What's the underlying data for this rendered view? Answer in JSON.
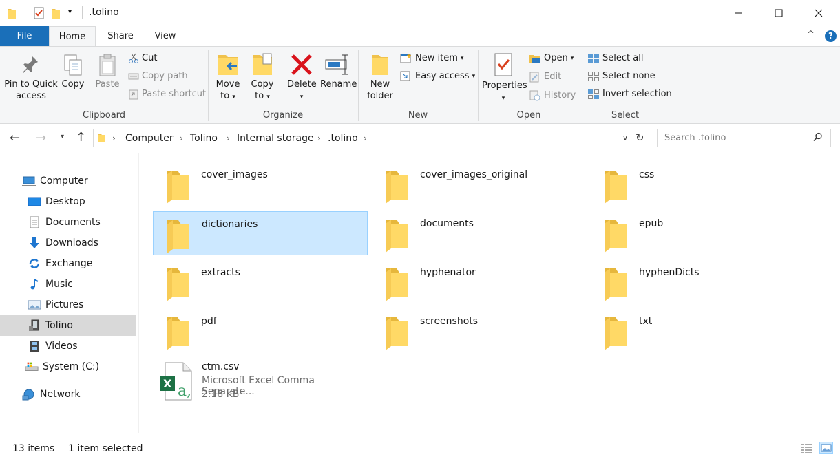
{
  "window": {
    "title": ".tolino",
    "accent": "#1a6fb9",
    "selection_color": "#cce8ff"
  },
  "tabs": {
    "file": "File",
    "home": "Home",
    "share": "Share",
    "view": "View"
  },
  "ribbon": {
    "clipboard": {
      "label": "Clipboard",
      "pin": "Pin to Quick access",
      "pin_l1": "Pin to Quick",
      "pin_l2": "access",
      "copy": "Copy",
      "paste": "Paste",
      "cut": "Cut",
      "copy_path": "Copy path",
      "paste_shortcut": "Paste shortcut"
    },
    "organize": {
      "label": "Organize",
      "move_l1": "Move",
      "move_l2": "to",
      "copy_l1": "Copy",
      "copy_l2": "to",
      "delete": "Delete",
      "rename": "Rename"
    },
    "new": {
      "label": "New",
      "new_folder_l1": "New",
      "new_folder_l2": "folder",
      "new_item": "New item",
      "easy_access": "Easy access"
    },
    "open": {
      "label": "Open",
      "properties": "Properties",
      "open": "Open",
      "edit": "Edit",
      "history": "History"
    },
    "select": {
      "label": "Select",
      "select_all": "Select all",
      "select_none": "Select none",
      "invert_selection": "Invert selection"
    }
  },
  "address": {
    "crumbs": [
      "Computer",
      "Tolino",
      "Internal storage",
      ".tolino"
    ],
    "search_placeholder": "Search .tolino"
  },
  "nav_pane": {
    "items": [
      {
        "label": "Computer",
        "icon": "computer-icon"
      },
      {
        "label": "Desktop",
        "icon": "desktop-icon"
      },
      {
        "label": "Documents",
        "icon": "documents-icon"
      },
      {
        "label": "Downloads",
        "icon": "downloads-icon"
      },
      {
        "label": "Exchange",
        "icon": "exchange-icon"
      },
      {
        "label": "Music",
        "icon": "music-icon"
      },
      {
        "label": "Pictures",
        "icon": "pictures-icon"
      },
      {
        "label": "Tolino",
        "icon": "device-icon",
        "selected": true
      },
      {
        "label": "Videos",
        "icon": "videos-icon"
      },
      {
        "label": "System (C:)",
        "icon": "drive-icon"
      },
      {
        "label": "Network",
        "icon": "network-icon"
      }
    ]
  },
  "content": {
    "folders": [
      "cover_images",
      "cover_images_original",
      "css",
      "dictionaries",
      "documents",
      "epub",
      "extracts",
      "hyphenator",
      "hyphenDicts",
      "pdf",
      "screenshots",
      "txt"
    ],
    "selected_index": 3,
    "file": {
      "name": "ctm.csv",
      "type": "Microsoft Excel Comma Separate...",
      "size": "2.18 KB"
    }
  },
  "status": {
    "items": "13 items",
    "selected": "1 item selected"
  }
}
